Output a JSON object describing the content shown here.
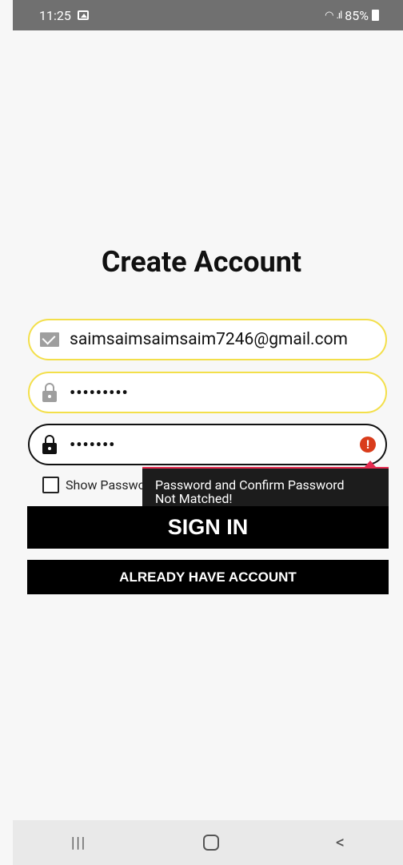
{
  "status_bar": {
    "time": "11:25",
    "battery": "85%",
    "icons": [
      "image-icon",
      "wifi-icon",
      "signal-icon",
      "battery-icon"
    ]
  },
  "page": {
    "title": "Create Account"
  },
  "form": {
    "email_value": "saimsaimsaimsaim7246@gmail.com",
    "password_value": "•••••••••",
    "confirm_password_value": "•••••••",
    "show_password_label": "Show Password",
    "error_message_line1": "Password and Confirm Password",
    "error_message_line2": "Not Matched!"
  },
  "buttons": {
    "sign_in": "SIGN IN",
    "already_have_account": "ALREADY HAVE ACCOUNT"
  },
  "nav": {
    "recent": "|||",
    "back": "<"
  },
  "colors": {
    "field_border_yellow": "#f3df4a",
    "error": "#d93c1b",
    "tooltip_accent": "#e52b50"
  }
}
